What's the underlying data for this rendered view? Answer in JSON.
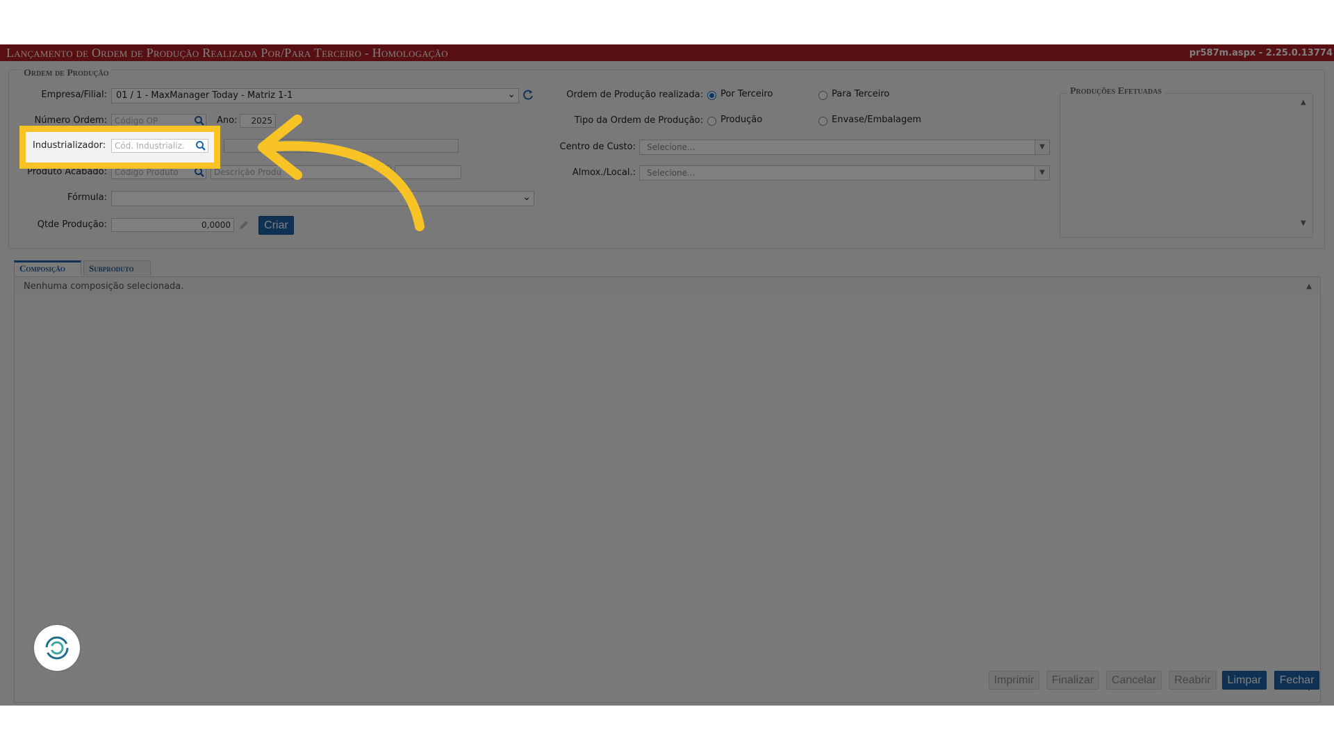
{
  "window": {
    "title": "Lançamento de Ordem de Produção Realizada Por/Para Terceiro  - Homologação",
    "version": "pr587m.aspx - 2.25.0.13774"
  },
  "form": {
    "legend": "Ordem de Produção",
    "empresa_label": "Empresa/Filial:",
    "empresa_value": "01 / 1 - MaxManager Today - Matriz 1-1",
    "numero_label": "Número Ordem:",
    "numero_placeholder": "Código OP",
    "ano_label": "Ano:",
    "ano_value": "2025",
    "industrializador_label": "Industrializador:",
    "industrializador_placeholder": "Cód. Industrializ.",
    "produto_label": "Produto Acabado:",
    "produto_placeholder": "Código Produto",
    "produto_desc_placeholder": "Descrição Produ",
    "formula_label": "Fórmula:",
    "qtde_label": "Qtde Produção:",
    "qtde_value": "0,0000",
    "criar_label": "Criar",
    "realizada_label": "Ordem de Produção realizada:",
    "por_terceiro_label": "Por Terceiro",
    "para_terceiro_label": "Para Terceiro",
    "tipo_label": "Tipo da Ordem de Produção:",
    "producao_label": "Produção",
    "envase_label": "Envase/Embalagem",
    "centro_label": "Centro de Custo:",
    "centro_placeholder": "Selecione...",
    "almox_label": "Almox./Local.:",
    "almox_placeholder": "Selecione..."
  },
  "producoes": {
    "legend": "Produções Efetuadas"
  },
  "tabs": [
    {
      "label": "Composição",
      "active": true
    },
    {
      "label": "Subproduto",
      "active": false
    }
  ],
  "composicao": {
    "empty_message": "Nenhuma composição selecionada."
  },
  "footer": {
    "imprimir": "Imprimir",
    "finalizar": "Finalizar",
    "cancelar": "Cancelar",
    "reabrir": "Reabrir",
    "limpar": "Limpar",
    "fechar": "Fechar"
  },
  "colors": {
    "titlebar": "#b01e23",
    "accent_blue": "#1f64a8",
    "highlight": "#f7c325"
  },
  "icons": [
    "search-icon",
    "refresh-icon",
    "pencil-icon",
    "chevron-down-icon",
    "arrow-annotation-icon",
    "app-logo-icon"
  ]
}
